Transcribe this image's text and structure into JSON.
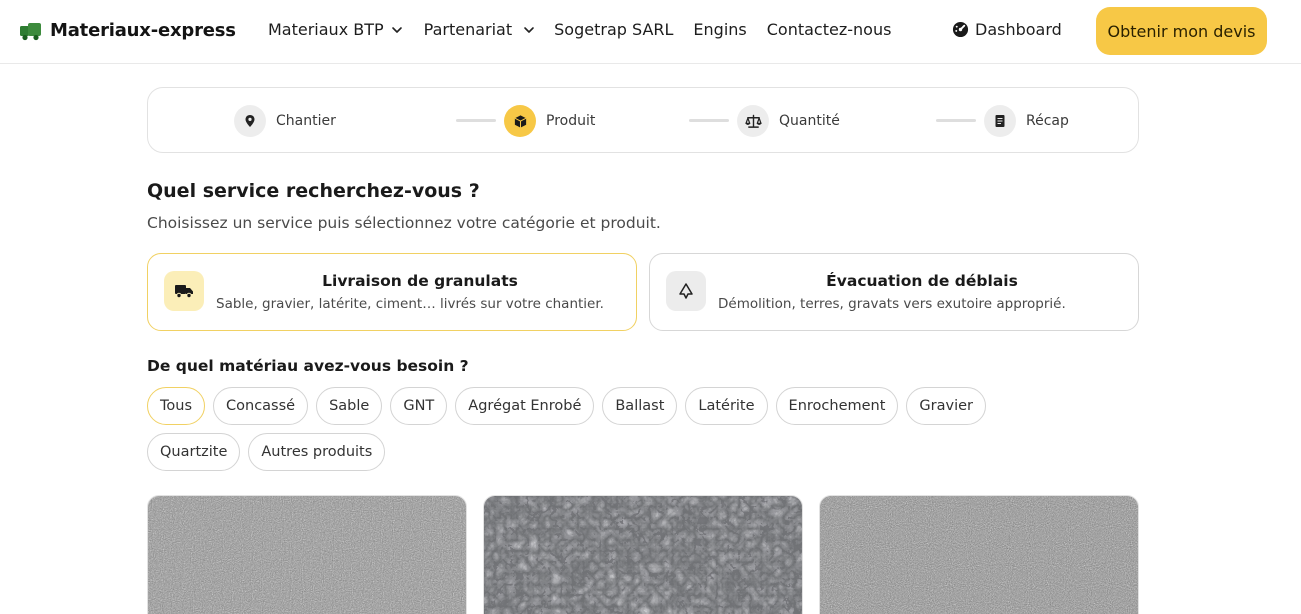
{
  "header": {
    "brand": "Materiaux-express",
    "nav": [
      {
        "label": "Materiaux BTP",
        "dropdown": true
      },
      {
        "label": "Partenariat",
        "dropdown": true
      },
      {
        "label": "Sogetrap SARL",
        "dropdown": false
      },
      {
        "label": "Engins",
        "dropdown": false
      },
      {
        "label": "Contactez-nous",
        "dropdown": false
      }
    ],
    "dashboard": "Dashboard",
    "cta": "Obtenir mon devis"
  },
  "stepper": {
    "steps": [
      {
        "label": "Chantier",
        "icon": "map-pin-icon",
        "active": false
      },
      {
        "label": "Produit",
        "icon": "box-icon",
        "active": true
      },
      {
        "label": "Quantité",
        "icon": "scale-icon",
        "active": false
      },
      {
        "label": "Récap",
        "icon": "receipt-icon",
        "active": false
      }
    ]
  },
  "service": {
    "title": "Quel service recherchez-vous ?",
    "subtitle": "Choisissez un service puis sélectionnez votre catégorie et produit.",
    "options": [
      {
        "title": "Livraison de granulats",
        "desc": "Sable, gravier, latérite, ciment… livrés sur votre chantier.",
        "icon": "truck-icon",
        "active": true
      },
      {
        "title": "Évacuation de déblais",
        "desc": "Démolition, terres, gravats vers exutoire approprié.",
        "icon": "recycle-icon",
        "active": false
      }
    ]
  },
  "materials": {
    "title": "De quel matériau avez-vous besoin ?",
    "chips": [
      "Tous",
      "Concassé",
      "Sable",
      "GNT",
      "Agrégat Enrobé",
      "Ballast",
      "Latérite",
      "Enrochement",
      "Gravier",
      "Quartzite",
      "Autres produits"
    ],
    "selected": "Tous"
  },
  "colors": {
    "accent": "#f7c846",
    "accent_border": "#f1d163",
    "brand_green": "#2e7d32"
  }
}
